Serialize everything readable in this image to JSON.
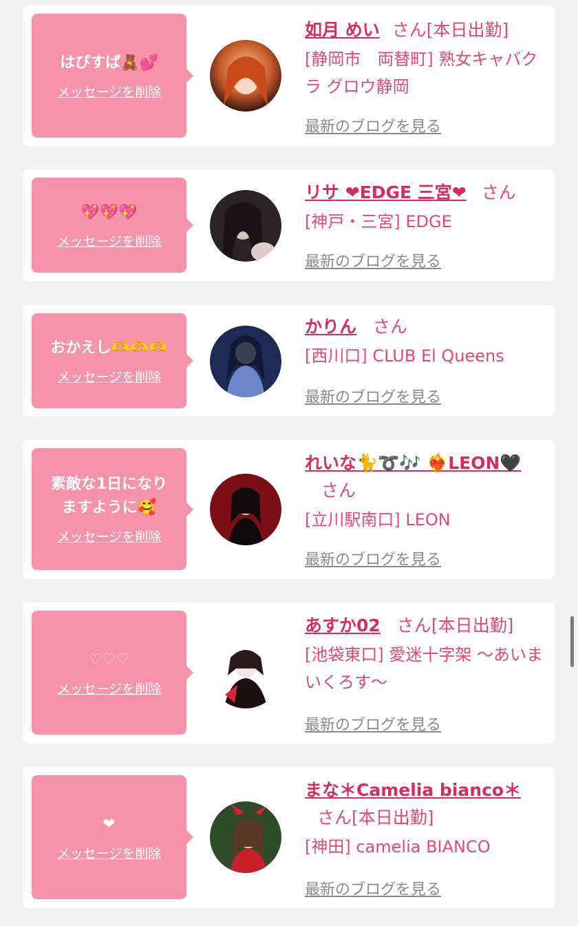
{
  "entries": [
    {
      "message": "はぴすぱ🧸💕",
      "delete_label": "メッセージを削除",
      "name": "如月 めい",
      "san": "さん",
      "status": "[本日出勤]",
      "shop": "[静岡市　両替町] 熟女キャバクラ グロウ静岡",
      "blog_label": "最新のブログを見る"
    },
    {
      "message": "💖💖💖",
      "delete_label": "メッセージを削除",
      "name": "リサ ❤EDGE 三宮❤",
      "san": "さん",
      "status": "",
      "shop": "[神戸・三宮] EDGE",
      "blog_label": "最新のブログを見る"
    },
    {
      "message": "おかえし🫶🫶🫶",
      "delete_label": "メッセージを削除",
      "name": "かりん",
      "san": "さん",
      "status": "",
      "shop": "[西川口] CLUB El Queens",
      "blog_label": "最新のブログを見る"
    },
    {
      "message": "素敵な1日になりますように🥰",
      "delete_label": "メッセージを削除",
      "name": "れいな🐈➰🎶 ❤️‍🔥LEON🖤",
      "san": "さん",
      "status": "",
      "shop": "[立川駅南口] LEON",
      "blog_label": "最新のブログを見る"
    },
    {
      "message": "♡♡♡",
      "delete_label": "メッセージを削除",
      "name": "あすか02",
      "san": "さん",
      "status": "[本日出勤]",
      "shop": "[池袋東口] 愛迷十字架 〜あいまいくろす〜",
      "blog_label": "最新のブログを見る"
    },
    {
      "message": "❤",
      "delete_label": "メッセージを削除",
      "name": "まな＊Camelia bianco＊",
      "san": "さん",
      "status": "[本日出勤]",
      "shop": "[神田] camelia BIANCO",
      "blog_label": "最新のブログを見る"
    }
  ],
  "colors": {
    "background": "#f2f2f2",
    "bubble": "#f693aa",
    "name": "#d62d5f",
    "text": "#e34975",
    "blog_link": "#8a8a8a"
  }
}
